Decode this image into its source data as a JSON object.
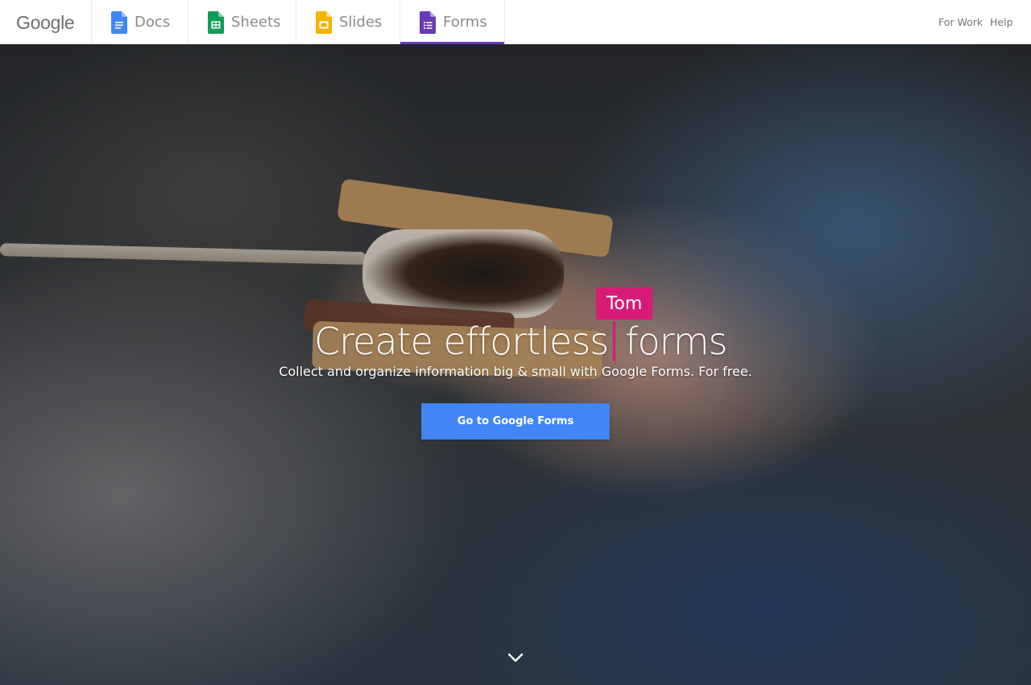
{
  "header": {
    "logo_text": "Google",
    "tabs": [
      {
        "label": "Docs",
        "color": "#4285f4"
      },
      {
        "label": "Sheets",
        "color": "#0f9d58"
      },
      {
        "label": "Slides",
        "color": "#f4b400"
      },
      {
        "label": "Forms",
        "color": "#673ab7",
        "active": true
      }
    ],
    "links": {
      "for_work": "For Work",
      "help": "Help"
    }
  },
  "hero": {
    "headline_before": "Create effortless",
    "headline_after": "forms",
    "collaborator_name": "Tom",
    "collaborator_color": "#d81b75",
    "subheadline": "Collect and organize information big & small with Google Forms. For free.",
    "cta_label": "Go to Google Forms",
    "cta_color": "#4285f4",
    "scroll_icon": "chevron-down-icon"
  }
}
